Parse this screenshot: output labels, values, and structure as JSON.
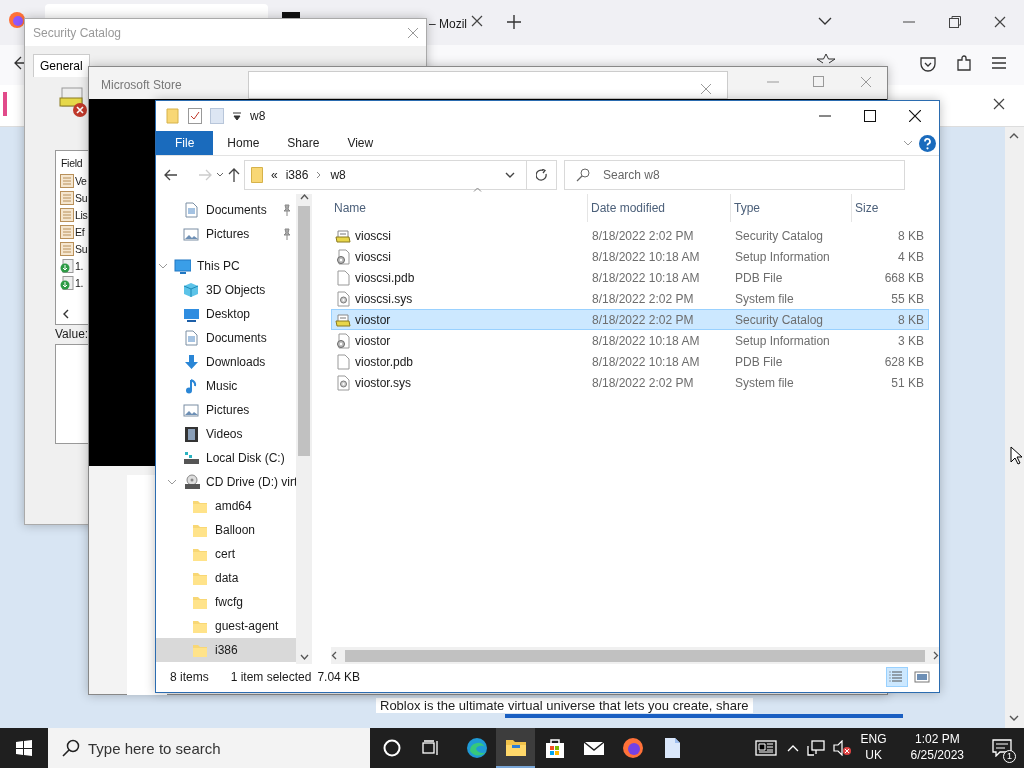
{
  "browser": {
    "tab_text": "– Mozil",
    "promo_text": "Roblox is the ultimate virtual universe that lets you create, share"
  },
  "security_catalog": {
    "title": "Security Catalog",
    "tabs": [
      {
        "label": "General",
        "selected": true
      }
    ],
    "field_header": "Field",
    "fields": [
      {
        "kind": "field",
        "text": "Ve"
      },
      {
        "kind": "field",
        "text": "Su"
      },
      {
        "kind": "field",
        "text": "Lis"
      },
      {
        "kind": "field",
        "text": "Ef"
      },
      {
        "kind": "field",
        "text": "Su"
      },
      {
        "kind": "extension",
        "text": "1."
      },
      {
        "kind": "extension",
        "text": "1."
      }
    ],
    "value_label": "Value:"
  },
  "store_window": {
    "title": "Microsoft Store"
  },
  "explorer": {
    "title": "w8",
    "ribbon_tabs": [
      {
        "label": "File",
        "selected": true
      },
      {
        "label": "Home",
        "selected": false
      },
      {
        "label": "Share",
        "selected": false
      },
      {
        "label": "View",
        "selected": false
      }
    ],
    "breadcrumb_overflow": "«",
    "breadcrumb": [
      "i386",
      "w8"
    ],
    "search": {
      "placeholder": "Search w8"
    },
    "quick_access": [
      {
        "label": "Documents",
        "kind": "doc",
        "pinned": true
      },
      {
        "label": "Pictures",
        "kind": "pictures",
        "pinned": true
      }
    ],
    "tree": [
      {
        "label": "This PC",
        "kind": "pc",
        "expanded": true,
        "selected": false,
        "children": [
          {
            "label": "3D Objects",
            "kind": "cube",
            "selected": false
          },
          {
            "label": "Desktop",
            "kind": "desktop",
            "selected": false
          },
          {
            "label": "Documents",
            "kind": "doc",
            "selected": false
          },
          {
            "label": "Downloads",
            "kind": "download",
            "selected": false
          },
          {
            "label": "Music",
            "kind": "music",
            "selected": false
          },
          {
            "label": "Pictures",
            "kind": "pictures",
            "selected": false
          },
          {
            "label": "Videos",
            "kind": "video",
            "selected": false
          },
          {
            "label": "Local Disk (C:)",
            "kind": "disk",
            "selected": false
          },
          {
            "label": "CD Drive (D:) virt",
            "kind": "cd",
            "expanded": true,
            "selected": false,
            "children": [
              {
                "label": "amd64",
                "kind": "folder",
                "selected": false
              },
              {
                "label": "Balloon",
                "kind": "folder",
                "selected": false
              },
              {
                "label": "cert",
                "kind": "folder",
                "selected": false
              },
              {
                "label": "data",
                "kind": "folder",
                "selected": false
              },
              {
                "label": "fwcfg",
                "kind": "folder",
                "selected": false
              },
              {
                "label": "guest-agent",
                "kind": "folder",
                "selected": false
              },
              {
                "label": "i386",
                "kind": "folder",
                "selected": true
              }
            ]
          }
        ]
      }
    ],
    "columns": [
      "Name",
      "Date modified",
      "Type",
      "Size"
    ],
    "files": [
      {
        "name": "vioscsi",
        "date": "8/18/2022 2:02 PM",
        "type": "Security Catalog",
        "size": "8 KB",
        "kind": "catalog",
        "selected": false
      },
      {
        "name": "vioscsi",
        "date": "8/18/2022 10:18 AM",
        "type": "Setup Information",
        "size": "4 KB",
        "kind": "setup",
        "selected": false
      },
      {
        "name": "vioscsi.pdb",
        "date": "8/18/2022 10:18 AM",
        "type": "PDB File",
        "size": "668 KB",
        "kind": "pdb",
        "selected": false
      },
      {
        "name": "vioscsi.sys",
        "date": "8/18/2022 2:02 PM",
        "type": "System file",
        "size": "55 KB",
        "kind": "sys",
        "selected": false
      },
      {
        "name": "viostor",
        "date": "8/18/2022 2:02 PM",
        "type": "Security Catalog",
        "size": "8 KB",
        "kind": "catalog",
        "selected": true
      },
      {
        "name": "viostor",
        "date": "8/18/2022 10:18 AM",
        "type": "Setup Information",
        "size": "3 KB",
        "kind": "setup",
        "selected": false
      },
      {
        "name": "viostor.pdb",
        "date": "8/18/2022 10:18 AM",
        "type": "PDB File",
        "size": "628 KB",
        "kind": "pdb",
        "selected": false
      },
      {
        "name": "viostor.sys",
        "date": "8/18/2022 2:02 PM",
        "type": "System file",
        "size": "51 KB",
        "kind": "sys",
        "selected": false
      }
    ],
    "status": {
      "count": "8 items",
      "selection": "1 item selected",
      "size": "7.04 KB"
    },
    "views": [
      {
        "kind": "details",
        "selected": true
      },
      {
        "kind": "tiles",
        "selected": false
      }
    ]
  },
  "taskbar": {
    "search_placeholder": "Type here to search",
    "apps": [
      {
        "kind": "edge",
        "selected": false
      },
      {
        "kind": "explorer",
        "selected": true
      },
      {
        "kind": "store",
        "selected": false
      },
      {
        "kind": "mail",
        "selected": false
      },
      {
        "kind": "firefox",
        "selected": false
      },
      {
        "kind": "notepad",
        "selected": false
      }
    ],
    "language": "ENG",
    "region": "UK",
    "time": "1:02 PM",
    "date": "6/25/2023",
    "notifications": "1"
  }
}
